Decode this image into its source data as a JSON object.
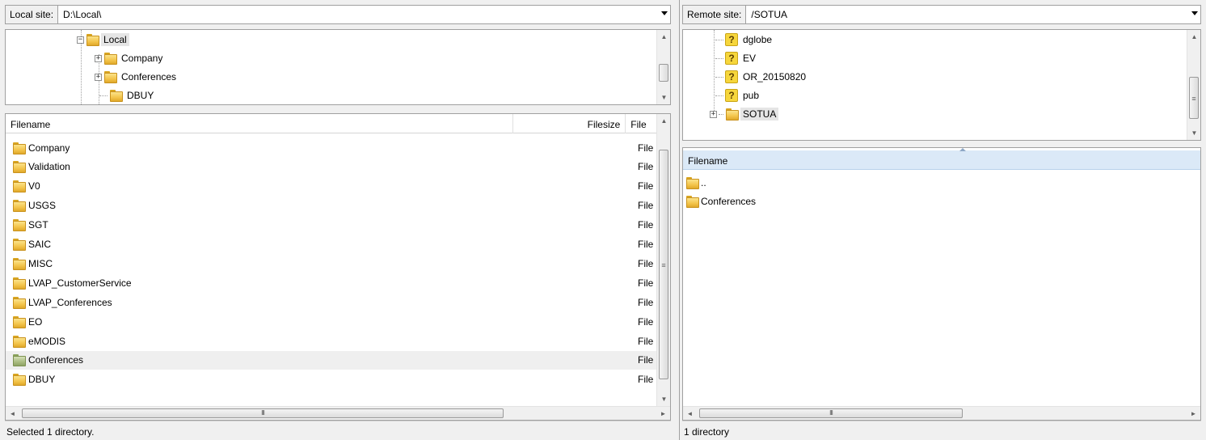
{
  "local": {
    "site_label": "Local site:",
    "site_path": "D:\\Local\\",
    "tree": [
      {
        "label": "Local",
        "expander": "−",
        "selected": true
      },
      {
        "label": "Company",
        "expander": "+"
      },
      {
        "label": "Conferences",
        "expander": "+"
      },
      {
        "label": "DBUY",
        "expander": ""
      }
    ],
    "columns": {
      "filename": "Filename",
      "filesize": "Filesize",
      "filetype": "File"
    },
    "files": [
      {
        "name": "Company",
        "type": "File"
      },
      {
        "name": "Validation",
        "type": "File"
      },
      {
        "name": "V0",
        "type": "File"
      },
      {
        "name": "USGS",
        "type": "File"
      },
      {
        "name": "SGT",
        "type": "File"
      },
      {
        "name": "SAIC",
        "type": "File"
      },
      {
        "name": "MISC",
        "type": "File"
      },
      {
        "name": "LVAP_CustomerService",
        "type": "File"
      },
      {
        "name": "LVAP_Conferences",
        "type": "File"
      },
      {
        "name": "EO",
        "type": "File"
      },
      {
        "name": "eMODIS",
        "type": "File"
      },
      {
        "name": "Conferences",
        "type": "File",
        "selected": true
      },
      {
        "name": "DBUY",
        "type": "File"
      }
    ],
    "status": "Selected 1 directory."
  },
  "remote": {
    "site_label": "Remote site:",
    "site_path": "/SOTUA",
    "tree": [
      {
        "label": "dglobe",
        "icon": "question-folder-icon"
      },
      {
        "label": "EV",
        "icon": "question-folder-icon"
      },
      {
        "label": "OR_20150820",
        "icon": "question-folder-icon"
      },
      {
        "label": "pub",
        "icon": "question-folder-icon"
      },
      {
        "label": "SOTUA",
        "icon": "folder-icon",
        "expander": "+",
        "selected": true
      }
    ],
    "columns": {
      "filename": "Filename"
    },
    "files": [
      {
        "name": ".."
      },
      {
        "name": "Conferences"
      }
    ],
    "status": "1 directory"
  },
  "scroll_glyphs": {
    "up": "▲",
    "down": "▼",
    "left": "◄",
    "right": "►",
    "grip": "III",
    "vgrip": "≡"
  }
}
